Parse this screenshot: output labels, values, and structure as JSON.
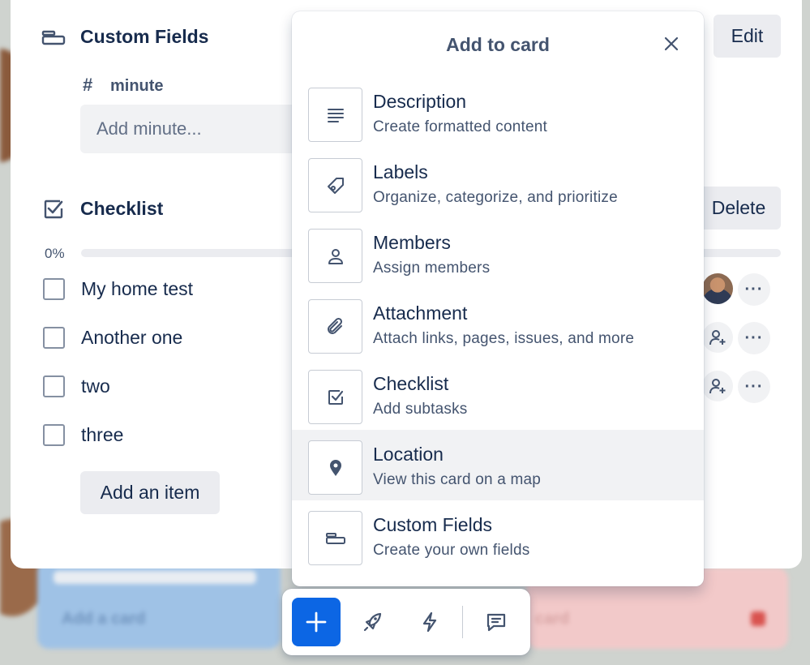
{
  "card": {
    "custom_fields": {
      "title": "Custom Fields",
      "edit_label": "Edit",
      "field_name": "minute",
      "field_placeholder": "Add minute..."
    },
    "checklist": {
      "title": "Checklist",
      "delete_label": "Delete",
      "progress_text": "0%",
      "progress": 0,
      "items": [
        {
          "text": "My home test",
          "checked": false,
          "assignee": "avatar"
        },
        {
          "text": "Another one",
          "checked": false,
          "assignee": "add-member-icon"
        },
        {
          "text": "two",
          "checked": false,
          "assignee": "add-member-icon"
        },
        {
          "text": "three",
          "checked": false,
          "assignee": null
        }
      ],
      "add_item_label": "Add an item"
    }
  },
  "popover": {
    "title": "Add to card",
    "items": [
      {
        "title": "Description",
        "subtitle": "Create formatted content",
        "icon": "description-icon"
      },
      {
        "title": "Labels",
        "subtitle": "Organize, categorize, and prioritize",
        "icon": "label-icon"
      },
      {
        "title": "Members",
        "subtitle": "Assign members",
        "icon": "member-icon"
      },
      {
        "title": "Attachment",
        "subtitle": "Attach links, pages, issues, and more",
        "icon": "paperclip-icon"
      },
      {
        "title": "Checklist",
        "subtitle": "Add subtasks",
        "icon": "checklist-icon"
      },
      {
        "title": "Location",
        "subtitle": "View this card on a map",
        "icon": "location-pin-icon",
        "highlighted": true
      },
      {
        "title": "Custom Fields",
        "subtitle": "Create your own fields",
        "icon": "custom-fields-icon"
      }
    ]
  },
  "background": {
    "left_card_text": "Add a card",
    "right_card_text": "card"
  },
  "colors": {
    "accent": "#0c66e4",
    "text": "#172b4d",
    "subtle_text": "#44546f",
    "button_bg": "#ebecf0",
    "highlight_bg": "#f1f2f4"
  }
}
